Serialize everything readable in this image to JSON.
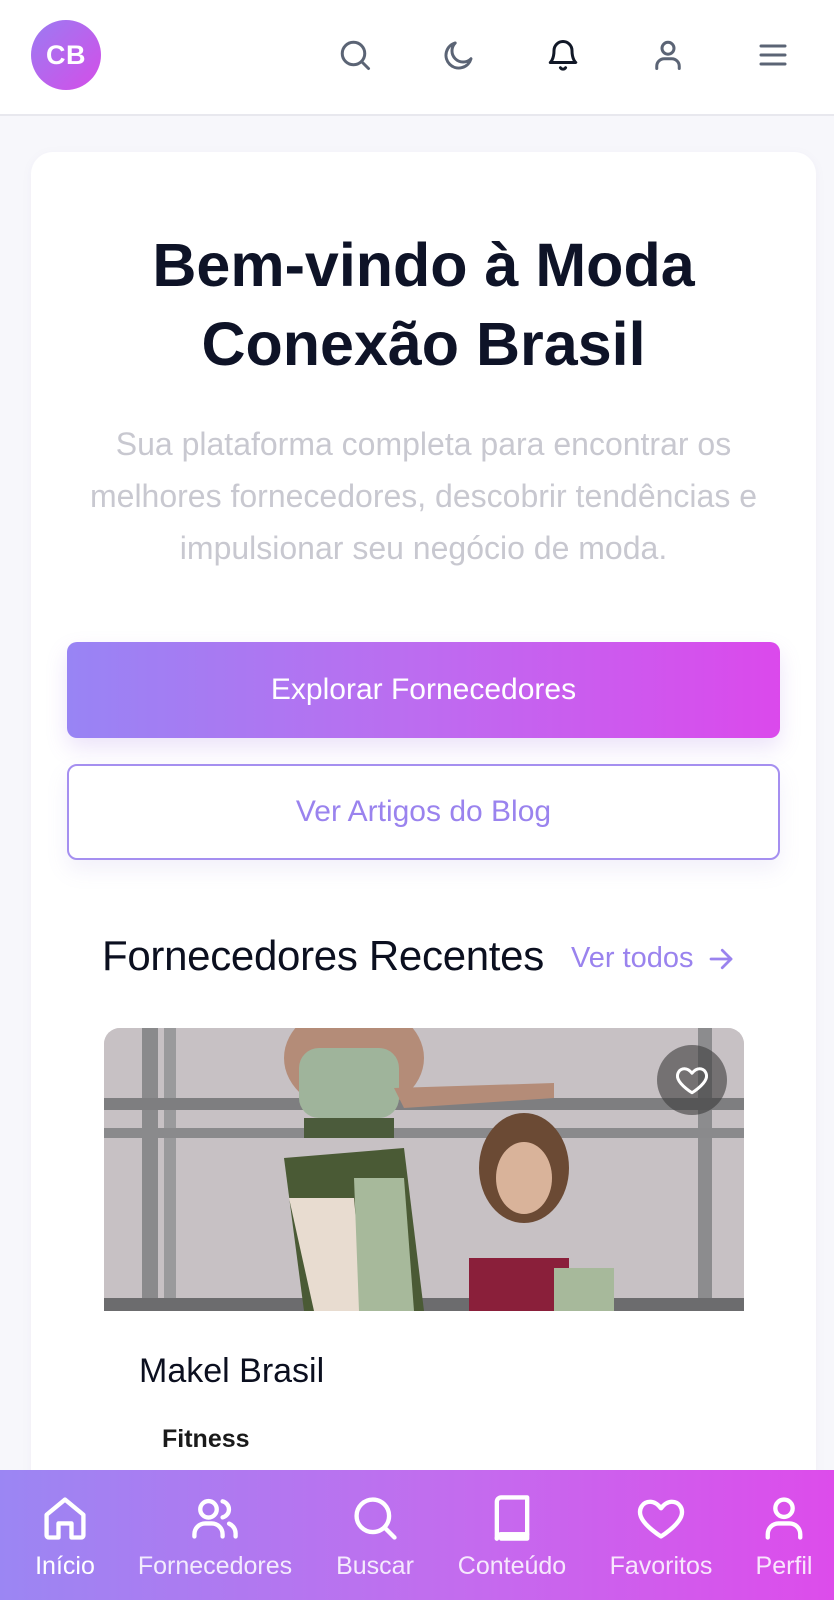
{
  "header": {
    "avatar_initials": "CB",
    "icons": [
      "search-icon",
      "moon-icon",
      "bell-icon",
      "user-icon",
      "menu-icon"
    ]
  },
  "hero": {
    "title": "Bem-vindo à Moda Conexão Brasil",
    "subtitle": "Sua plataforma completa para encontrar os melhores fornecedores, descobrir tendências e impulsionar seu negócio de moda.",
    "primary_button": "Explorar Fornecedores",
    "secondary_button": "Ver Artigos do Blog"
  },
  "recent_suppliers": {
    "title": "Fornecedores Recentes",
    "see_all": "Ver todos",
    "items": [
      {
        "name": "Makel Brasil",
        "category": "Fitness",
        "favorited": false
      }
    ]
  },
  "bottom_nav": {
    "items": [
      {
        "label": "Início",
        "icon": "home-icon",
        "active": true
      },
      {
        "label": "Fornecedores",
        "icon": "users-icon",
        "active": false
      },
      {
        "label": "Buscar",
        "icon": "search-icon",
        "active": false
      },
      {
        "label": "Conteúdo",
        "icon": "book-icon",
        "active": false
      },
      {
        "label": "Favoritos",
        "icon": "heart-icon",
        "active": false
      },
      {
        "label": "Perfil",
        "icon": "user-icon",
        "active": false
      }
    ]
  },
  "colors": {
    "accent_start": "#9884f4",
    "accent_end": "#db49ec",
    "accent_text": "#9a83ee"
  }
}
